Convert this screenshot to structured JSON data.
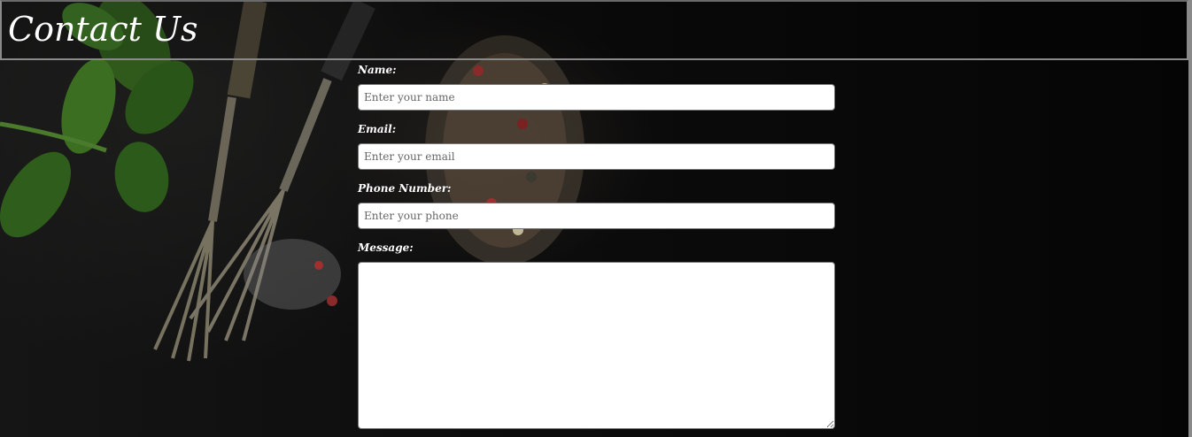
{
  "header": {
    "title": "Contact Us"
  },
  "form": {
    "name": {
      "label": "Name:",
      "placeholder": "Enter your name",
      "value": ""
    },
    "email": {
      "label": "Email:",
      "placeholder": "Enter your email",
      "value": ""
    },
    "phone": {
      "label": "Phone Number:",
      "placeholder": "Enter your phone",
      "value": ""
    },
    "message": {
      "label": "Message:",
      "value": ""
    }
  },
  "colors": {
    "background": "#0a0a0a",
    "text": "#ffffff",
    "border": "#8a8a8a",
    "input_bg": "#ffffff"
  }
}
